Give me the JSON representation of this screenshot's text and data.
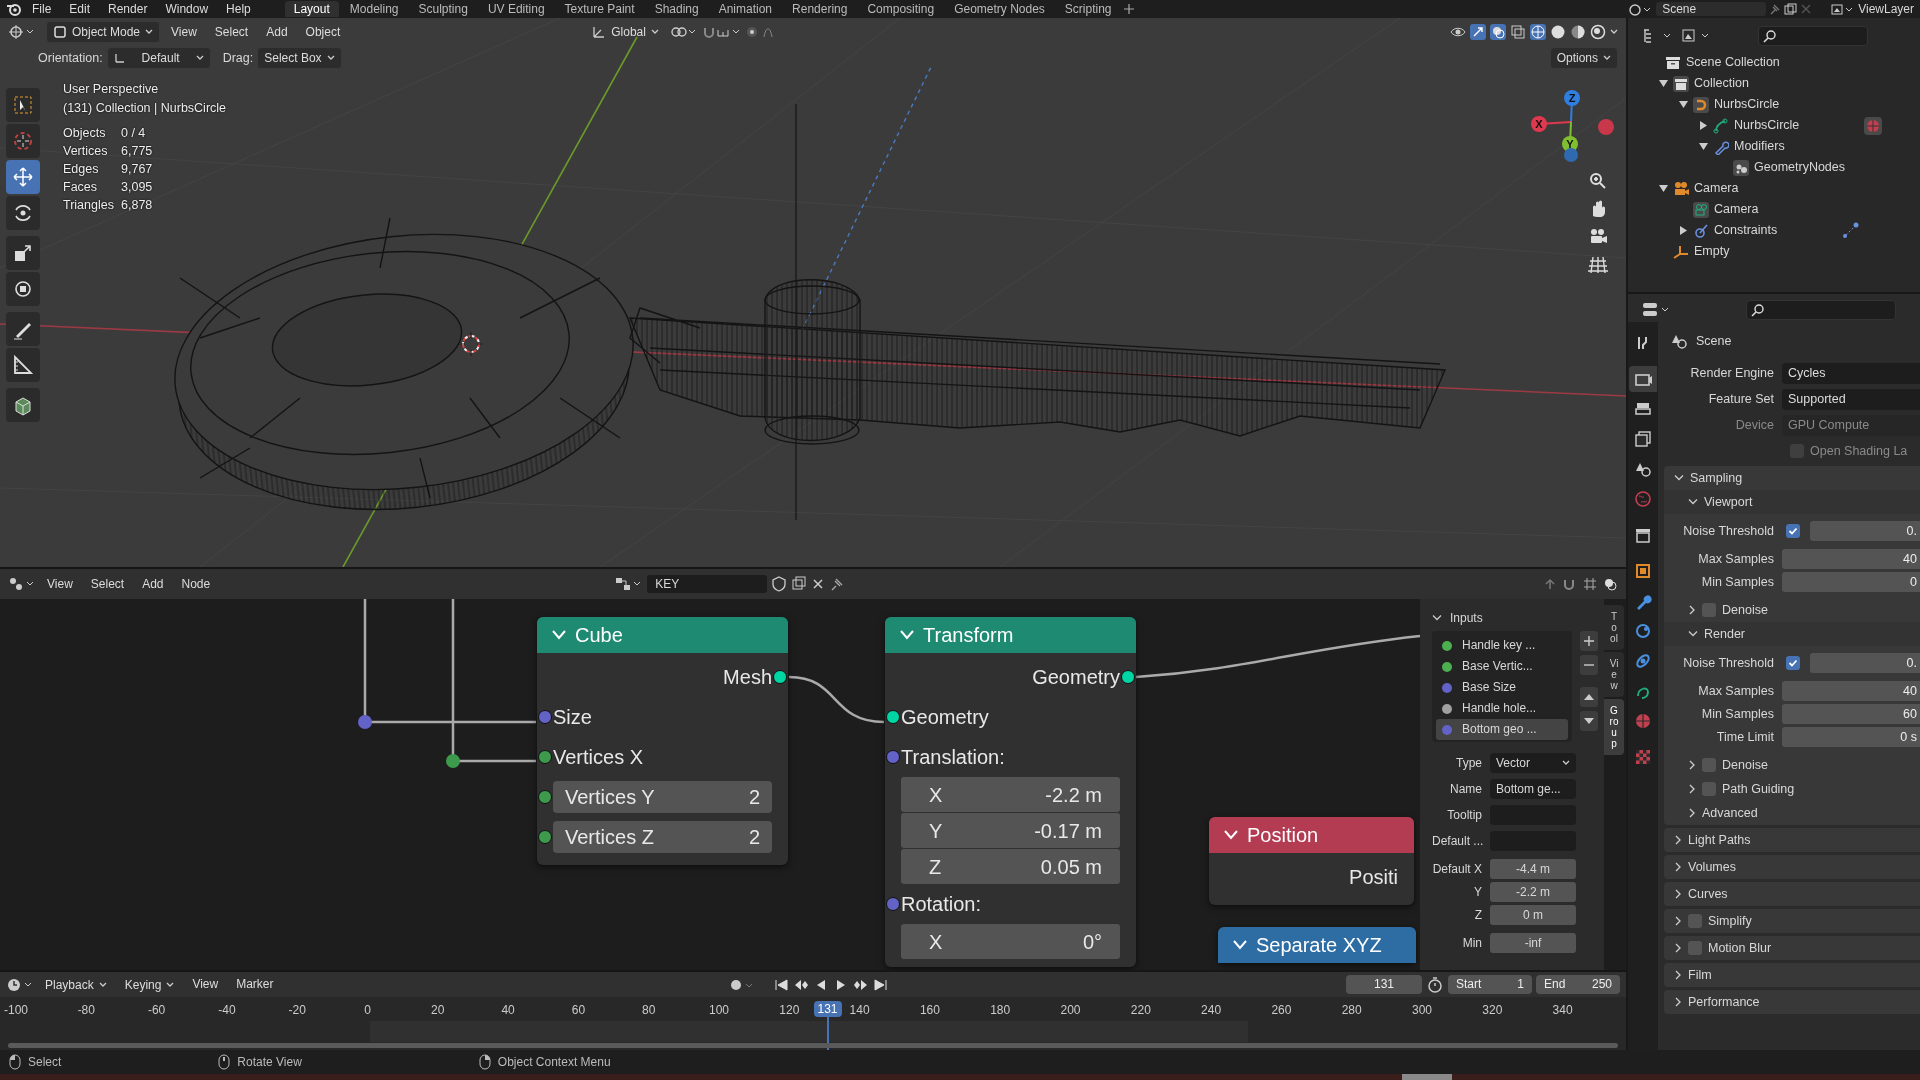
{
  "top_menu": [
    "File",
    "Edit",
    "Render",
    "Window",
    "Help"
  ],
  "workspaces": [
    {
      "label": "Layout",
      "selected": true
    },
    {
      "label": "Modeling",
      "selected": false
    },
    {
      "label": "Sculpting",
      "selected": false
    },
    {
      "label": "UV Editing",
      "selected": false
    },
    {
      "label": "Texture Paint",
      "selected": false
    },
    {
      "label": "Shading",
      "selected": false
    },
    {
      "label": "Animation",
      "selected": false
    },
    {
      "label": "Rendering",
      "selected": false
    },
    {
      "label": "Compositing",
      "selected": false
    },
    {
      "label": "Geometry Nodes",
      "selected": false
    },
    {
      "label": "Scripting",
      "selected": false
    }
  ],
  "scene": "Scene",
  "view_layer": "ViewLayer",
  "viewport": {
    "mode": "Object Mode",
    "menus": [
      "View",
      "Select",
      "Add",
      "Object"
    ],
    "transform_orientation": "Global",
    "options": "Options",
    "orientation_label": "Orientation:",
    "orientation": "Default",
    "drag_label": "Drag:",
    "drag": "Select Box",
    "tools": [
      {
        "kind": "select",
        "selected": false
      },
      {
        "kind": "cursor",
        "selected": false
      },
      {
        "kind": "move",
        "selected": true
      },
      {
        "kind": "rotate",
        "selected": false
      },
      {
        "kind": "scale",
        "selected": false
      },
      {
        "kind": "transform",
        "selected": false
      },
      {
        "kind": "annotate",
        "selected": false
      },
      {
        "kind": "measure",
        "selected": false
      },
      {
        "kind": "add-cube",
        "selected": false
      }
    ],
    "view_name": "User Perspective",
    "context": "(131) Collection | NurbsCircle",
    "stats": [
      {
        "label": "Objects",
        "value": "0 / 4"
      },
      {
        "label": "Vertices",
        "value": "6,775"
      },
      {
        "label": "Edges",
        "value": "9,767"
      },
      {
        "label": "Faces",
        "value": "3,095"
      },
      {
        "label": "Triangles",
        "value": "6,878"
      }
    ],
    "gizmo_axes": [
      {
        "label": "Z",
        "color": "#2f7ee0"
      },
      {
        "label": "X",
        "color": "#e0394f"
      },
      {
        "label": "Y",
        "color": "#80c030"
      }
    ]
  },
  "outliner": {
    "tree": [
      {
        "label": "Scene Collection",
        "kind": "scene-collection",
        "children": [
          {
            "label": "Collection",
            "kind": "collection",
            "expanded": true,
            "children": [
              {
                "label": "NurbsCircle",
                "kind": "curve-object",
                "expanded": true,
                "children": [
                  {
                    "label": "NurbsCircle",
                    "kind": "curve-data",
                    "expanded": false
                  },
                  {
                    "label": "Modifiers",
                    "kind": "modifiers",
                    "expanded": true,
                    "children": [
                      {
                        "label": "GeometryNodes",
                        "kind": "geonodes"
                      }
                    ]
                  }
                ]
              }
            ]
          },
          {
            "label": "Camera",
            "kind": "camera-object",
            "expanded": true,
            "children": [
              {
                "label": "Camera",
                "kind": "camera-data"
              },
              {
                "label": "Constraints",
                "kind": "constraints",
                "expanded": false
              }
            ]
          },
          {
            "label": "Empty",
            "kind": "empty"
          }
        ]
      }
    ]
  },
  "properties": {
    "tabs": [
      {
        "kind": "tool",
        "selected": false
      },
      {
        "kind": "render",
        "selected": true
      },
      {
        "kind": "output",
        "selected": false
      },
      {
        "kind": "view-layer",
        "selected": false
      },
      {
        "kind": "scene",
        "selected": false
      },
      {
        "kind": "world",
        "selected": false
      },
      {
        "kind": "collection",
        "selected": false
      },
      {
        "kind": "object",
        "selected": false
      },
      {
        "kind": "modifiers",
        "selected": false
      },
      {
        "kind": "particles",
        "selected": false
      },
      {
        "kind": "physics",
        "selected": false
      },
      {
        "kind": "data",
        "selected": false
      },
      {
        "kind": "material",
        "selected": false
      },
      {
        "kind": "texture",
        "selected": false
      }
    ],
    "context": "Scene",
    "fields": [
      {
        "label": "Render Engine",
        "value": "Cycles",
        "disabled": false
      },
      {
        "label": "Feature Set",
        "value": "Supported",
        "disabled": false
      },
      {
        "label": "Device",
        "value": "GPU Compute",
        "disabled": true
      }
    ],
    "open_shading": {
      "label": "Open Shading La",
      "checked": false,
      "disabled": true
    },
    "panels": [
      {
        "label": "Sampling",
        "expanded": true,
        "subpanels": [
          {
            "label": "Viewport",
            "expanded": true,
            "rows": [
              {
                "kind": "check-number",
                "label": "Noise Threshold",
                "checked": true,
                "value": "0."
              },
              {
                "kind": "number",
                "label": "Max Samples",
                "value": "40"
              },
              {
                "kind": "number",
                "label": "Min Samples",
                "value": "0"
              }
            ]
          },
          {
            "label": "Denoise",
            "expanded": false,
            "checked": false
          },
          {
            "label": "Render",
            "expanded": true,
            "rows": [
              {
                "kind": "check-number",
                "label": "Noise Threshold",
                "checked": true,
                "value": "0."
              },
              {
                "kind": "number",
                "label": "Max Samples",
                "value": "40"
              },
              {
                "kind": "number",
                "label": "Min Samples",
                "value": "60"
              },
              {
                "kind": "number",
                "label": "Time Limit",
                "value": "0 s"
              }
            ]
          },
          {
            "label": "Denoise",
            "expanded": false,
            "checked": false
          },
          {
            "label": "Path Guiding",
            "expanded": false,
            "checked": false
          },
          {
            "label": "Advanced",
            "expanded": false
          }
        ]
      },
      {
        "label": "Light Paths",
        "expanded": false
      },
      {
        "label": "Volumes",
        "expanded": false
      },
      {
        "label": "Curves",
        "expanded": false
      },
      {
        "label": "Simplify",
        "expanded": false,
        "checked": false
      },
      {
        "label": "Motion Blur",
        "expanded": false,
        "checked": false
      },
      {
        "label": "Film",
        "expanded": false
      },
      {
        "label": "Performance",
        "expanded": false
      }
    ]
  },
  "node_editor": {
    "menus": [
      "View",
      "Select",
      "Add",
      "Node"
    ],
    "node_group": "KEY",
    "nodes": [
      {
        "title": "Cube",
        "color": "#1e8a72",
        "rows": [
          {
            "kind": "output",
            "label": "Mesh",
            "color": "#00d6a3"
          },
          {
            "kind": "input",
            "label": "Size",
            "color": "#6363c7"
          },
          {
            "kind": "input",
            "label": "Vertices X",
            "color": "#3d9a4c"
          },
          {
            "kind": "field",
            "label": "Vertices Y",
            "value": "2",
            "color": "#3d9a4c"
          },
          {
            "kind": "field",
            "label": "Vertices Z",
            "value": "2",
            "color": "#3d9a4c"
          }
        ]
      },
      {
        "title": "Transform",
        "color": "#1e8a72",
        "rows": [
          {
            "kind": "output",
            "label": "Geometry",
            "color": "#00d6a3"
          },
          {
            "kind": "input",
            "label": "Geometry",
            "color": "#00d6a3"
          },
          {
            "kind": "input",
            "label": "Translation:",
            "color": "#6363c7"
          },
          {
            "kind": "vector",
            "items": [
              {
                "label": "X",
                "value": "-2.2 m"
              },
              {
                "label": "Y",
                "value": "-0.17 m"
              },
              {
                "label": "Z",
                "value": "0.05 m"
              }
            ]
          },
          {
            "kind": "input",
            "label": "Rotation:",
            "color": "#6363c7"
          },
          {
            "kind": "vector",
            "items": [
              {
                "label": "X",
                "value": "0°"
              }
            ]
          }
        ]
      },
      {
        "title": "Position",
        "color": "#b33b52",
        "rows": [
          {
            "kind": "label-right",
            "label": "Positi"
          }
        ]
      },
      {
        "title": "Separate XYZ",
        "color": "#2e6da4"
      }
    ],
    "sidebar": {
      "tabs": [
        {
          "label": "Tool",
          "selected": false
        },
        {
          "label": "View",
          "selected": false
        },
        {
          "label": "Group",
          "selected": true
        }
      ],
      "panel": "Inputs",
      "inputs": [
        {
          "label": "Handle key ...",
          "color": "#4caf50",
          "selected": false
        },
        {
          "label": "Base Vertic...",
          "color": "#4caf50",
          "selected": false
        },
        {
          "label": "Base Size",
          "color": "#6363c7",
          "selected": false
        },
        {
          "label": "Handle hole...",
          "color": "#a0a0a0",
          "selected": false
        },
        {
          "label": "Bottom geo ...",
          "color": "#6363c7",
          "selected": true
        }
      ],
      "fields": [
        {
          "label": "Type",
          "kind": "dropdown",
          "value": "Vector"
        },
        {
          "label": "Name",
          "kind": "text",
          "value": "Bottom ge..."
        },
        {
          "label": "Tooltip",
          "kind": "text"
        },
        {
          "label": "Default ...",
          "kind": "text"
        },
        {
          "label": "Default X",
          "kind": "number",
          "value": "-4.4 m"
        },
        {
          "label": "Y",
          "kind": "number",
          "value": "-2.2 m"
        },
        {
          "label": "Z",
          "kind": "number",
          "value": "0 m"
        },
        {
          "label": "Min",
          "kind": "number",
          "value": "-inf"
        }
      ]
    }
  },
  "timeline": {
    "menus": [
      "Playback",
      "Keying",
      "View",
      "Marker"
    ],
    "current_frame": "131",
    "start_label": "Start",
    "start": "1",
    "end_label": "End",
    "end": "250",
    "ticks": [
      "-100",
      "-80",
      "-60",
      "-40",
      "-20",
      "0",
      "20",
      "40",
      "60",
      "80",
      "100",
      "120",
      "140",
      "160",
      "180",
      "200",
      "220",
      "240",
      "260",
      "280",
      "300",
      "320",
      "340"
    ],
    "playhead": {
      "label": "131",
      "level": 0.514
    }
  },
  "status_bar": [
    {
      "label": "Select",
      "kind": "mouse-left"
    },
    {
      "label": "Rotate View",
      "kind": "mouse-middle"
    },
    {
      "label": "Object Context Menu",
      "kind": "mouse-right"
    }
  ]
}
